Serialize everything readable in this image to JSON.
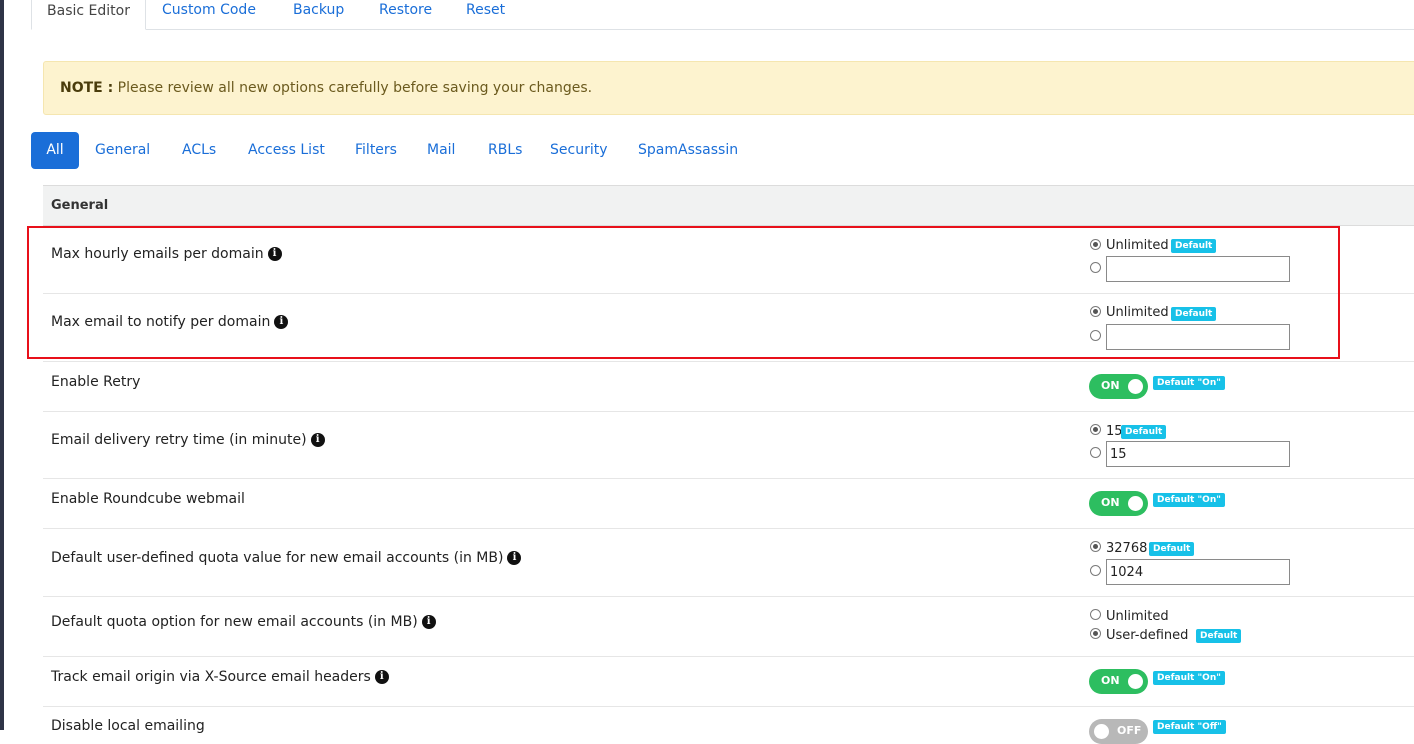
{
  "top_tabs": [
    "Basic Editor",
    "Custom Code",
    "Backup",
    "Restore",
    "Reset"
  ],
  "note": {
    "label": "NOTE :",
    "text": " Please review all new options carefully before saving your changes."
  },
  "filters": [
    "All",
    "General",
    "ACLs",
    "Access List",
    "Filters",
    "Mail",
    "RBLs",
    "Security",
    "SpamAssassin"
  ],
  "section": "General",
  "rows": {
    "max_hourly": {
      "label": "Max hourly emails per domain",
      "default_option": "Unlimited",
      "badge": "Default",
      "input_value": ""
    },
    "max_notify": {
      "label": "Max email to notify per domain",
      "default_option": "Unlimited",
      "badge": "Default",
      "input_value": ""
    },
    "enable_retry": {
      "label": "Enable Retry",
      "toggle": "ON",
      "badge": "Default \"On\""
    },
    "retry_time": {
      "label": "Email delivery retry time (in minute)",
      "default_option": "15",
      "badge": "Default",
      "input_value": "15"
    },
    "roundcube": {
      "label": "Enable Roundcube webmail",
      "toggle": "ON",
      "badge": "Default \"On\""
    },
    "quota_value": {
      "label": "Default user-defined quota value for new email accounts (in MB)",
      "default_option": "32768",
      "badge": "Default",
      "input_value": "1024"
    },
    "quota_option": {
      "label": "Default quota option for new email accounts (in MB)",
      "option1": "Unlimited",
      "option2": "User-defined",
      "badge": "Default"
    },
    "x_source": {
      "label": "Track email origin via X-Source email headers",
      "toggle": "ON",
      "badge": "Default \"On\""
    },
    "local_mail": {
      "label": "Disable local emailing",
      "toggle": "OFF",
      "badge": "Default \"Off\""
    }
  },
  "icons": {
    "info": "info-circle-icon"
  },
  "colors": {
    "accent": "#1a6ed8",
    "toggle_on": "#2dbe60",
    "badge": "#17c1e8",
    "highlight": "#e8101a",
    "note_bg": "#fdf3cf"
  }
}
